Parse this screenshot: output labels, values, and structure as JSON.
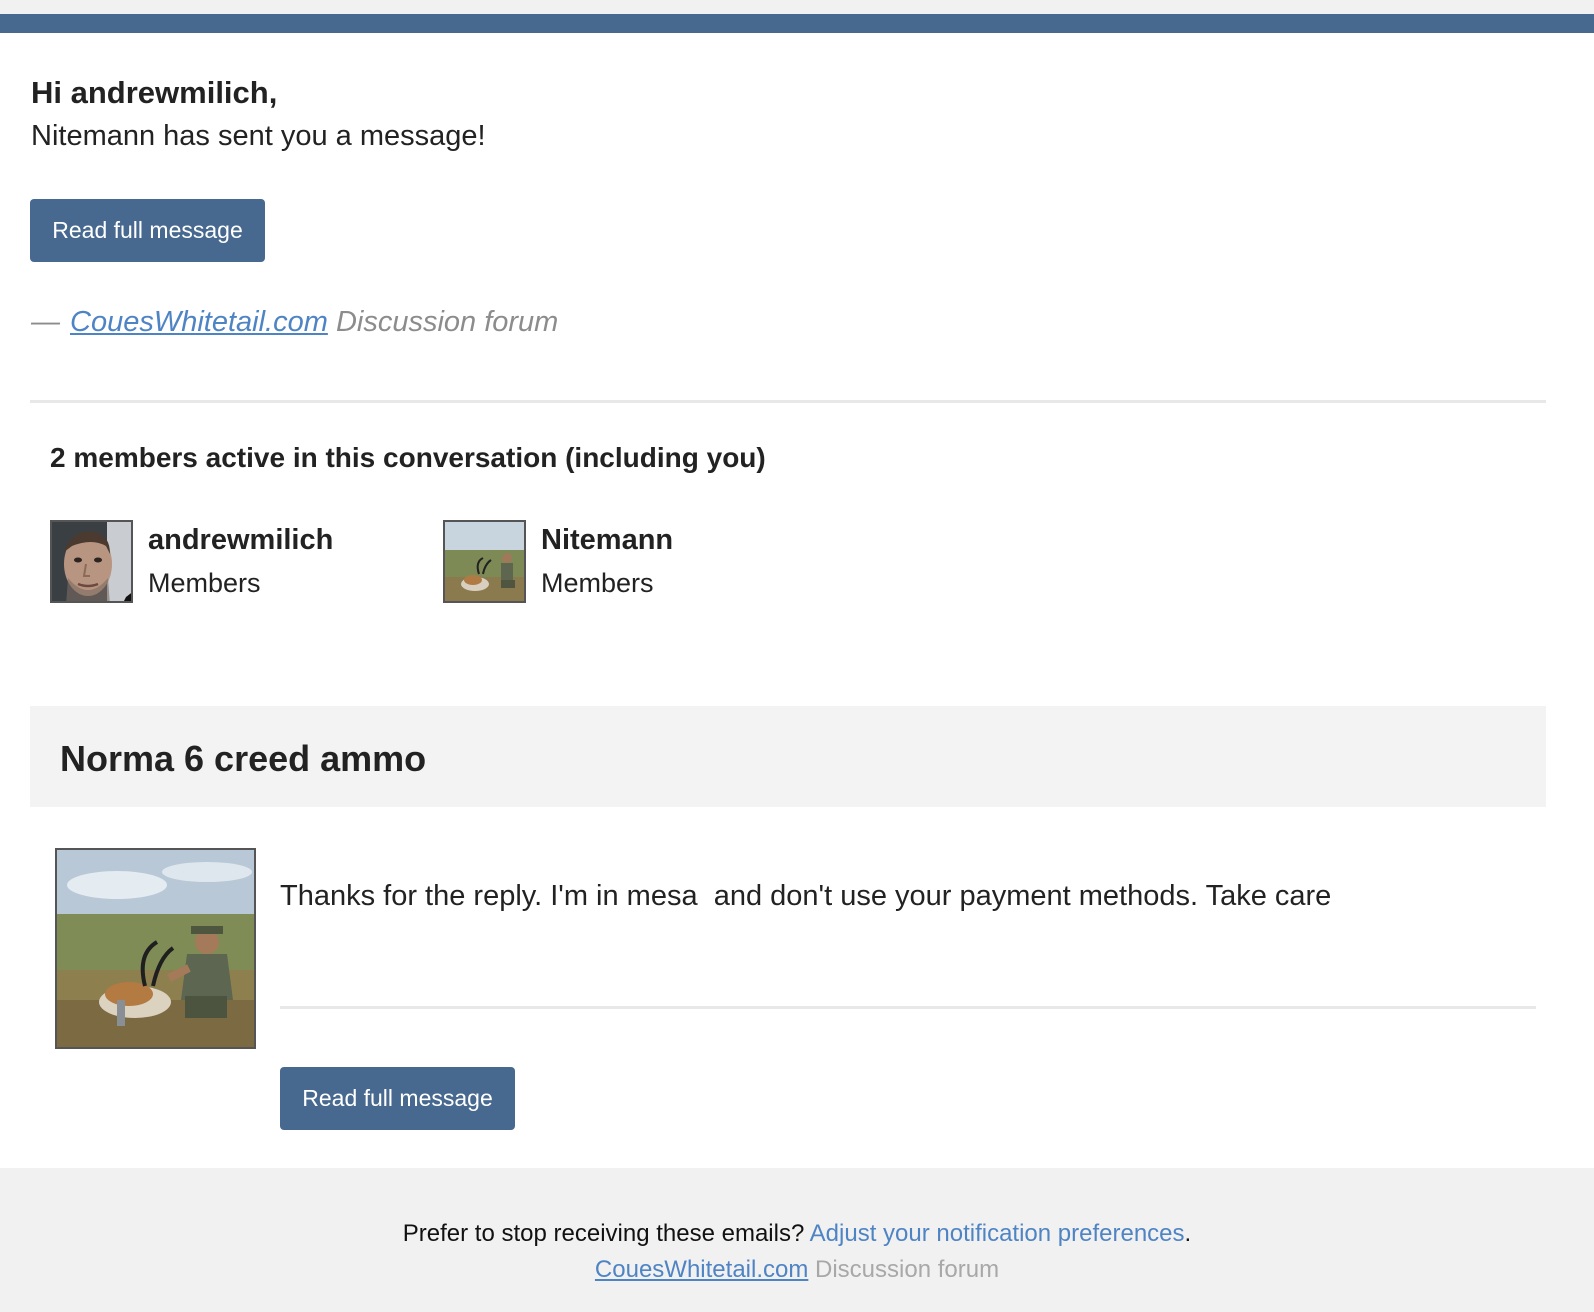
{
  "email": {
    "greeting": "Hi andrewmilich,",
    "subline": "Nitemann has sent you a message!",
    "read_button_label": "Read full message",
    "signature": {
      "dash": "—",
      "site_link": "CouesWhitetail.com",
      "suffix": "Discussion forum"
    }
  },
  "members": {
    "title": "2 members active in this conversation (including you)",
    "list": [
      {
        "name": "andrewmilich",
        "role": "Members",
        "avatar": "man-portrait-avatar"
      },
      {
        "name": "Nitemann",
        "role": "Members",
        "avatar": "hunter-with-antelope-avatar"
      }
    ]
  },
  "conversation": {
    "title": "Norma 6 creed ammo",
    "message": "Thanks for the reply. I'm in mesa  and don't use your payment methods. Take care",
    "read_button_label": "Read full message",
    "author_avatar": "hunter-with-antelope-avatar"
  },
  "footer": {
    "prompt": "Prefer to stop receiving these emails?",
    "preferences_link": "Adjust your notification preferences",
    "period": ".",
    "site_link": "CouesWhitetail.com",
    "site_suffix": "Discussion forum"
  },
  "colors": {
    "brand": "#47698f",
    "link": "#4f84c4",
    "muted": "#8c8c8c",
    "panel": "#f3f3f3"
  }
}
